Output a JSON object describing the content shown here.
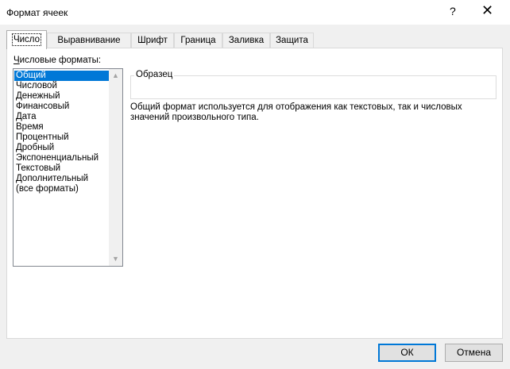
{
  "window": {
    "title": "Формат ячеек",
    "help_label": "?",
    "close_label": "✕"
  },
  "tabs": [
    {
      "label": "Число",
      "active": true
    },
    {
      "label": "Выравнивание",
      "active": false
    },
    {
      "label": "Шрифт",
      "active": false
    },
    {
      "label": "Граница",
      "active": false
    },
    {
      "label": "Заливка",
      "active": false
    },
    {
      "label": "Защита",
      "active": false
    }
  ],
  "number_tab": {
    "formats_label_accel": "Ч",
    "formats_label_rest": "исловые форматы:",
    "categories": [
      "Общий",
      "Числовой",
      "Денежный",
      "Финансовый",
      "Дата",
      "Время",
      "Процентный",
      "Дробный",
      "Экспоненциальный",
      "Текстовый",
      "Дополнительный",
      "(все форматы)"
    ],
    "selected_category": "Общий",
    "sample_label": "Образец",
    "sample_value": "",
    "description": "Общий формат используется для отображения как текстовых, так и числовых значений произвольного типа."
  },
  "buttons": {
    "ok_label": "ОК",
    "cancel_label": "Отмена"
  },
  "colors": {
    "selection": "#0078d7",
    "default_button_border": "#0078d7"
  }
}
